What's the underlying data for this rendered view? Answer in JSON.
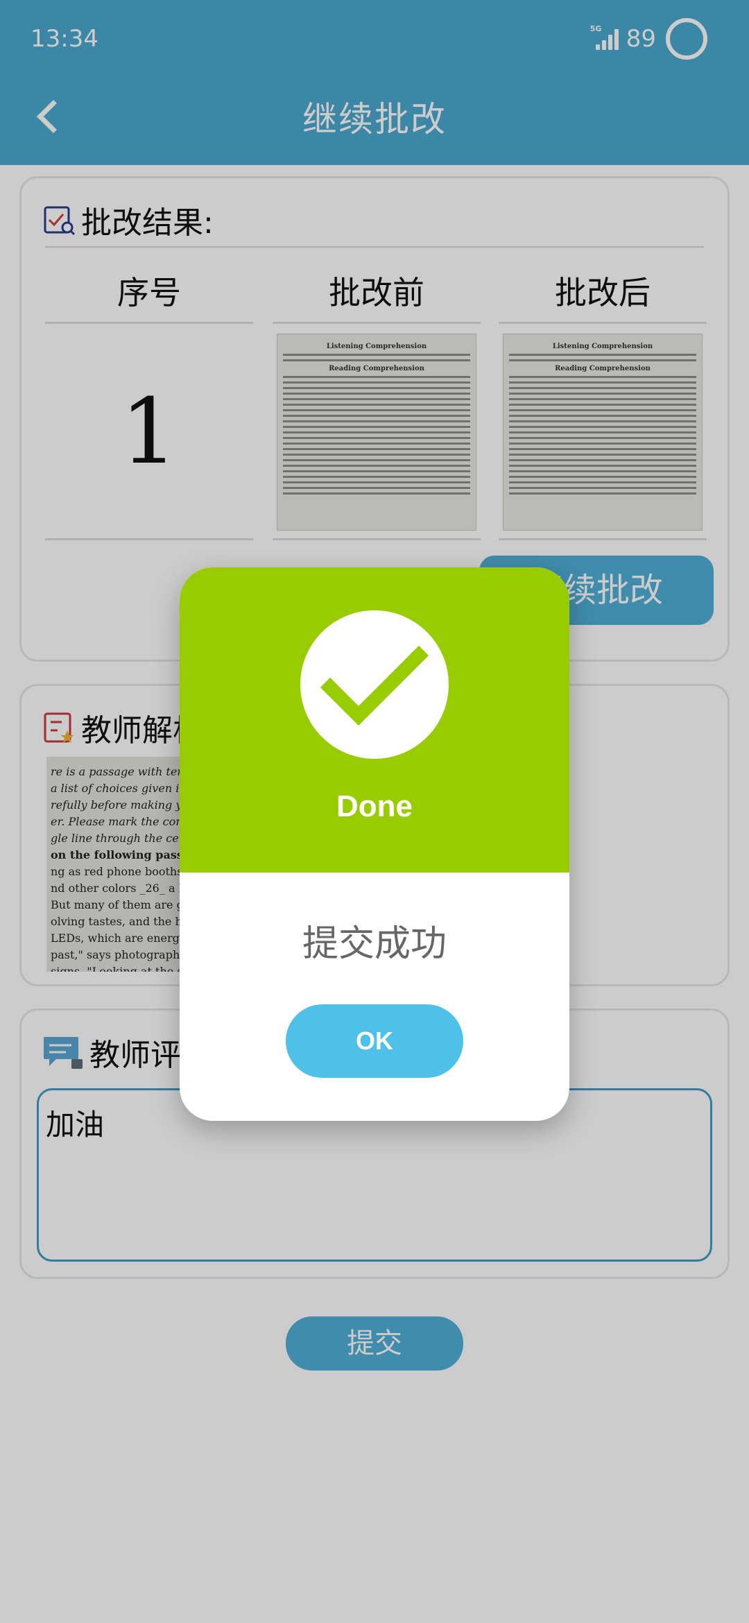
{
  "status_bar": {
    "time": "13:34",
    "network": "5G",
    "battery": "89"
  },
  "app_bar": {
    "title": "继续批改",
    "back_icon": "chevron-left-icon"
  },
  "result_card": {
    "heading": "批改结果:",
    "columns": [
      "序号",
      "批改前",
      "批改后"
    ],
    "row": {
      "seq": "1"
    },
    "doc_title_1": "Listening Comprehension",
    "doc_title_2": "Reading Comprehension",
    "continue_label": "继续批改"
  },
  "analysis_card": {
    "heading": "教师解析"
  },
  "comment_card": {
    "heading": "教师评语",
    "comment_value": "加油"
  },
  "submit_label": "提交",
  "dialog": {
    "title": "Done",
    "message": "提交成功",
    "ok_label": "OK",
    "accent_color": "#99cc00",
    "button_color": "#4fc0e8"
  },
  "colors": {
    "primary": "#4ba9cf",
    "border": "#3d9ccc"
  }
}
